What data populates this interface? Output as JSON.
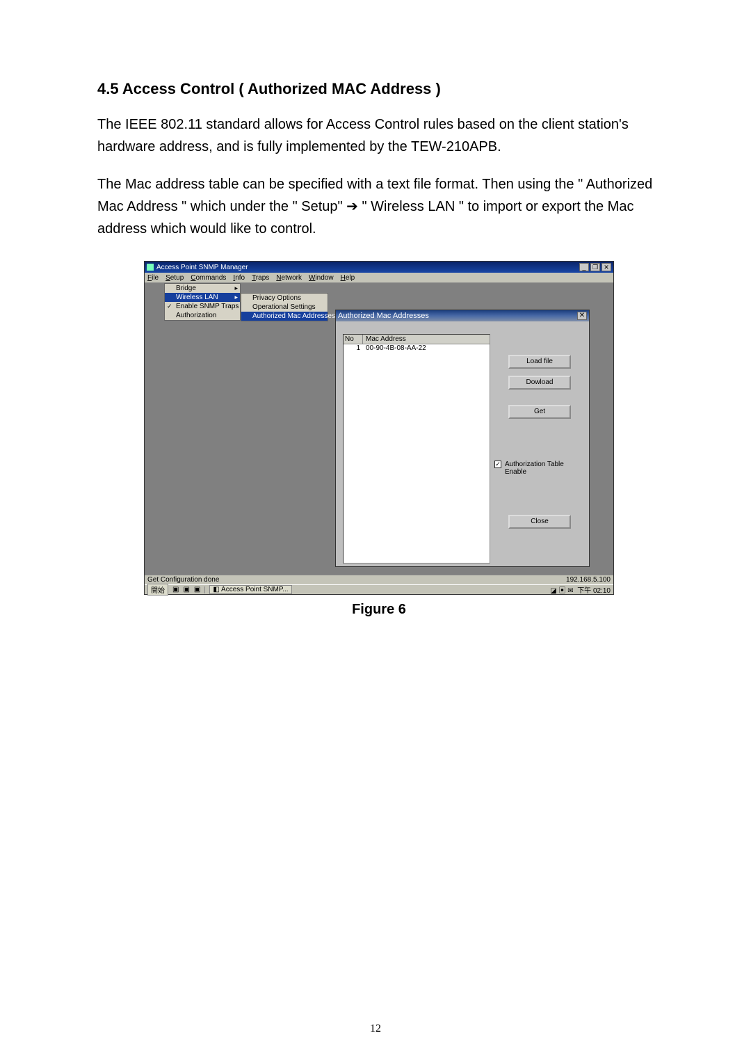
{
  "doc": {
    "heading": "4.5 Access Control ( Authorized MAC Address )",
    "para1": "The IEEE 802.11 standard allows for Access Control rules based on the client station's hardware address, and is fully implemented by the TEW-210APB.",
    "para2": "The Mac address table can be specified with a text file format. Then using the \" Authorized Mac Address \" which under the \" Setup\" ➔ \" Wireless LAN \" to import or export the Mac address which would like to control.",
    "figure_caption": "Figure 6",
    "page_number": "12"
  },
  "app": {
    "window_title": "Access Point SNMP Manager",
    "menubar": [
      "File",
      "Setup",
      "Commands",
      "Info",
      "Traps",
      "Network",
      "Window",
      "Help"
    ],
    "setup_menu": {
      "items": [
        {
          "label": "Bridge",
          "submenu": true
        },
        {
          "label": "Wireless LAN",
          "submenu": true,
          "highlight": true
        },
        {
          "label": "Enable SNMP Traps",
          "checked": true
        },
        {
          "label": "Authorization"
        }
      ]
    },
    "wlan_menu": {
      "items": [
        {
          "label": "Privacy Options"
        },
        {
          "label": "Operational Settings"
        },
        {
          "label": "Authorized Mac Addresses",
          "highlight": true
        }
      ]
    },
    "dialog": {
      "title": "Authorized Mac Addresses",
      "columns": [
        "No",
        "Mac Address"
      ],
      "rows": [
        {
          "no": "1",
          "mac": "00-90-4B-08-AA-22"
        }
      ],
      "buttons": {
        "loadfile": "Load file",
        "download": "Dowload",
        "get": "Get",
        "close": "Close"
      },
      "checkbox_label": "Authorization Table Enable",
      "checkbox_checked": true
    },
    "statusbar": {
      "left": "Get Configuration done",
      "right": "192.168.5.100"
    },
    "taskbar": {
      "start": "開始",
      "active": "Access Point SNMP...",
      "time": "下午 02:10"
    }
  }
}
